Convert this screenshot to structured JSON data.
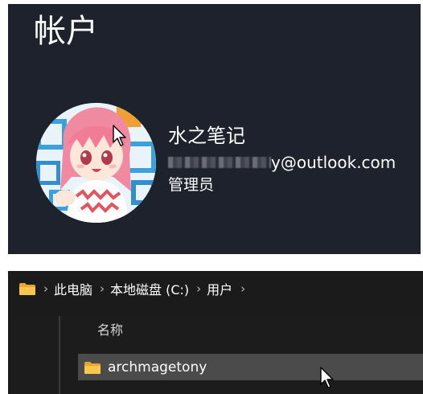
{
  "account": {
    "title": "帐户",
    "name": "水之笔记",
    "email_visible_fragment": "y@outlook.com",
    "role": "管理员"
  },
  "explorer": {
    "breadcrumbs": [
      "此电脑",
      "本地磁盘 (C:)",
      "用户"
    ],
    "column_header": "名称",
    "items": [
      {
        "name": "archmagetony",
        "type": "folder"
      }
    ]
  },
  "colors": {
    "settings_background": "#1e222d",
    "explorer_background": "#1b1b1b",
    "selected_row": "#4b4b4b",
    "folder_yellow": "#f5c24a",
    "text": "#ffffff"
  },
  "icons": {
    "address_folder": "folder-icon",
    "row_folder": "folder-icon",
    "separator": "chevron-right-icon",
    "pointer": "mouse-pointer-icon"
  }
}
